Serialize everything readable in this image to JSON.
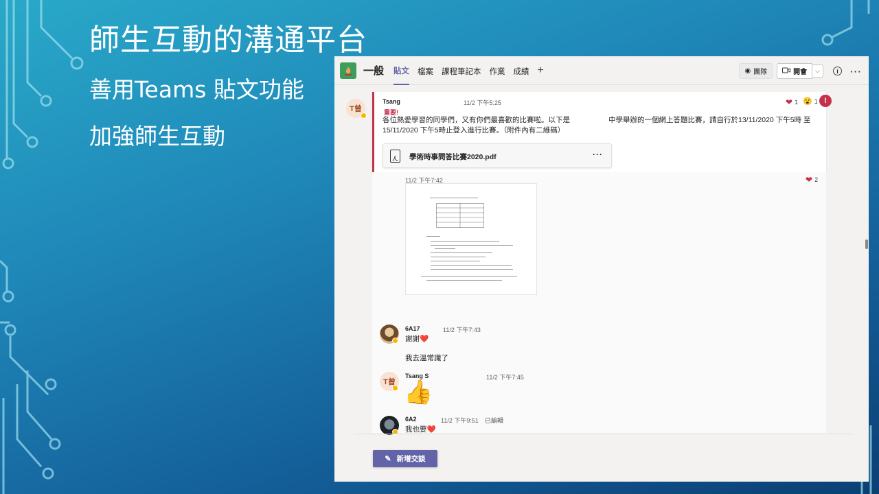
{
  "slide": {
    "title": "師生互動的溝通平台",
    "bullets": [
      "善用Teams 貼文功能",
      "加強師生互動"
    ]
  },
  "teams": {
    "channel_name": "一般",
    "tabs": [
      "貼文",
      "檔案",
      "課程筆記本",
      "作業",
      "成績"
    ],
    "add_tab": "+",
    "team_button": "團隊",
    "meet_button": "開會",
    "info_icon": "i",
    "more": "···",
    "post": {
      "author": "Tsang",
      "avatar_text": "T曾",
      "time": "11/2 下午5:25",
      "important_label": "重要!",
      "text_line1_a": "各位熱愛學習的同學們，又有你們最喜歡的比賽啦。以下是",
      "text_line1_b": "中學舉辦的一個網上答題比賽，請自行於13/11/2020 下午5時 至",
      "text_line2": "15/11/2020 下午5時止登入進行比賽。（附件內有二維碼）",
      "reactions": [
        {
          "icon": "❤",
          "count": "1"
        },
        {
          "icon": "😮",
          "count": "1"
        }
      ],
      "important_badge": "!",
      "attachment": {
        "name": "學術時事問答比賽2020.pdf",
        "more": "···"
      }
    },
    "replies": [
      {
        "time": "11/2 下午7:42",
        "reaction_count": "2",
        "type": "image"
      },
      {
        "author": "6A17",
        "time": "11/2 下午7:43",
        "lines": [
          "謝謝❤️",
          "我去溫常識了"
        ]
      },
      {
        "author": "Tsang S",
        "avatar_text": "T曾",
        "time": "11/2 下午7:45",
        "content": "👍"
      },
      {
        "author": "6A2",
        "time": "11/2 下午9:51",
        "edited": "已編輯",
        "lines": [
          "我也要❤️"
        ]
      }
    ],
    "new_conversation": "新增交談"
  }
}
